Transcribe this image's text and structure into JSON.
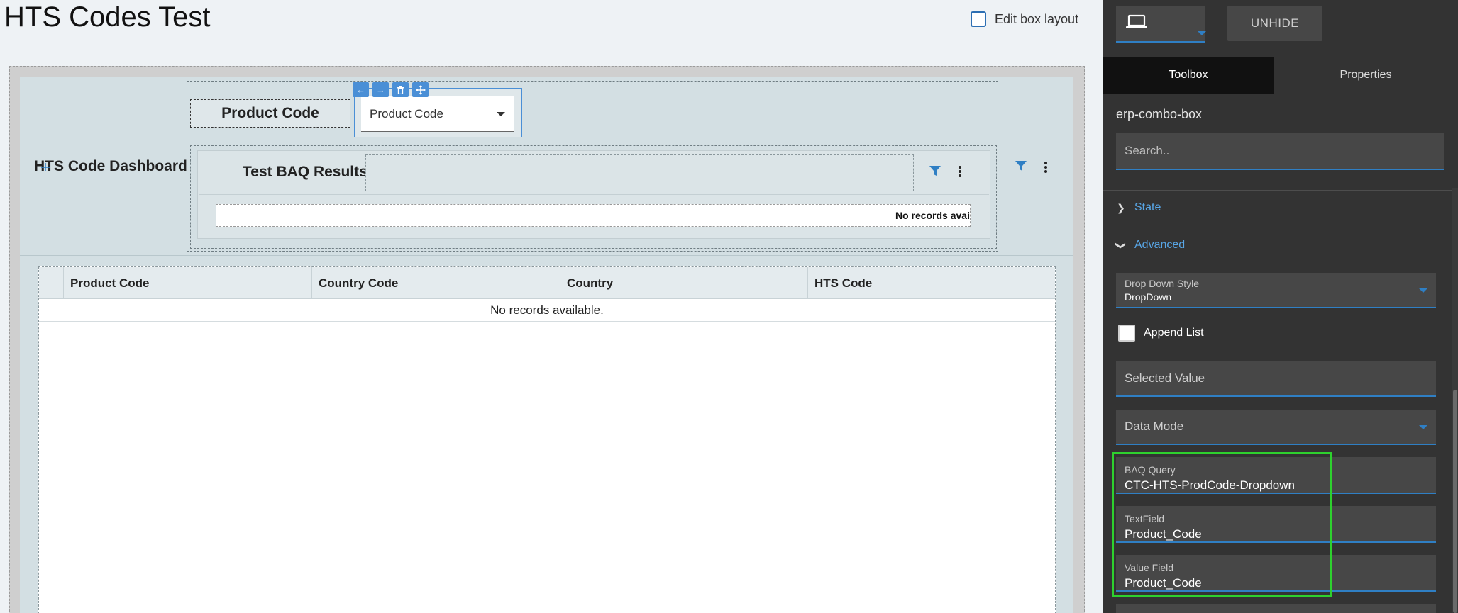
{
  "page": {
    "title": "HTS Codes Test",
    "edit_box_layout_label": "Edit box layout"
  },
  "layout_canvas": {
    "dashboard_label": "HTS Code Dashboard",
    "product_code_label": "Product Code",
    "product_code_combo_value": "Product Code",
    "baq_results_title": "Test BAQ Results",
    "baq_no_records": "No records avai",
    "grid": {
      "columns": [
        "Product Code",
        "Country Code",
        "Country",
        "HTS Code"
      ],
      "no_records": "No records available."
    }
  },
  "panel": {
    "unhide_label": "UNHIDE",
    "tabs": [
      "Toolbox",
      "Properties"
    ],
    "component_name": "erp-combo-box",
    "search_placeholder": "Search..",
    "sections": {
      "state": "State",
      "advanced": "Advanced"
    },
    "fields": {
      "drop_down_style": {
        "label": "Drop Down Style",
        "value": "DropDown"
      },
      "append_list": {
        "label": "Append List",
        "checked": false
      },
      "selected_value": {
        "placeholder": "Selected Value"
      },
      "data_mode": {
        "placeholder": "Data Mode"
      },
      "baq_query": {
        "label": "BAQ Query",
        "value": "CTC-HTS-ProdCode-Dropdown"
      },
      "text_field": {
        "label": "TextField",
        "value": "Product_Code"
      },
      "value_field": {
        "label": "Value Field",
        "value": "Product_Code"
      }
    }
  },
  "colors": {
    "accent": "#2f7fc4",
    "highlight": "#2ed12e",
    "panel_bg": "#333333"
  },
  "icons": {
    "device": "laptop-icon",
    "filter": "filter-icon",
    "kebab": "kebab-menu-icon",
    "move_left": "arrow-left-icon",
    "move_right": "arrow-right-icon",
    "delete": "trash-icon",
    "move": "move-icon"
  }
}
